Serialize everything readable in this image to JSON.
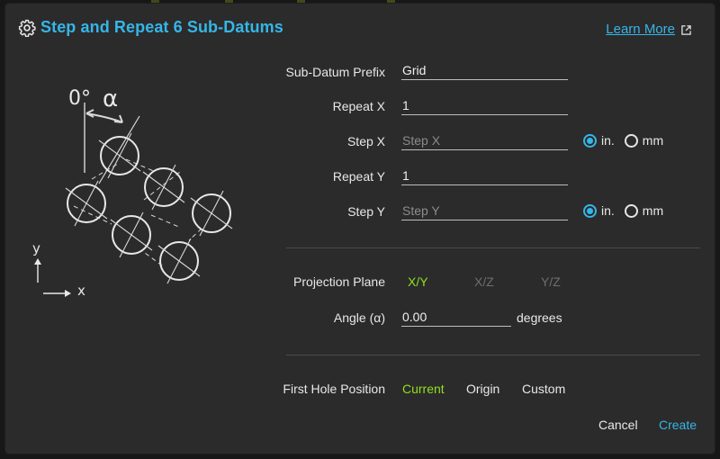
{
  "dialog": {
    "title": "Step and Repeat 6 Sub-Datums",
    "learn_more": "Learn More"
  },
  "diagram": {
    "angle_zero": "0°",
    "angle_alpha": "α",
    "axis_y": "y",
    "axis_x": "x"
  },
  "form": {
    "prefix": {
      "label": "Sub-Datum Prefix",
      "value": "Grid"
    },
    "repeat_x": {
      "label": "Repeat X",
      "value": "1"
    },
    "step_x": {
      "label": "Step X",
      "placeholder": "Step X",
      "units": [
        "in.",
        "mm"
      ],
      "selected": "in."
    },
    "repeat_y": {
      "label": "Repeat Y",
      "value": "1"
    },
    "step_y": {
      "label": "Step Y",
      "placeholder": "Step Y",
      "units": [
        "in.",
        "mm"
      ],
      "selected": "in."
    }
  },
  "projection": {
    "label": "Projection Plane",
    "options": [
      "X/Y",
      "X/Z",
      "Y/Z"
    ],
    "selected": "X/Y"
  },
  "angle": {
    "label": "Angle (α)",
    "value": "0.00",
    "unit": "degrees"
  },
  "first_hole": {
    "label": "First Hole Position",
    "options": [
      "Current",
      "Origin",
      "Custom"
    ],
    "selected": "Current"
  },
  "actions": {
    "cancel": "Cancel",
    "create": "Create"
  },
  "colors": {
    "accent": "#35b6e8",
    "active": "#8fe01e",
    "background": "#2b2b2b"
  }
}
